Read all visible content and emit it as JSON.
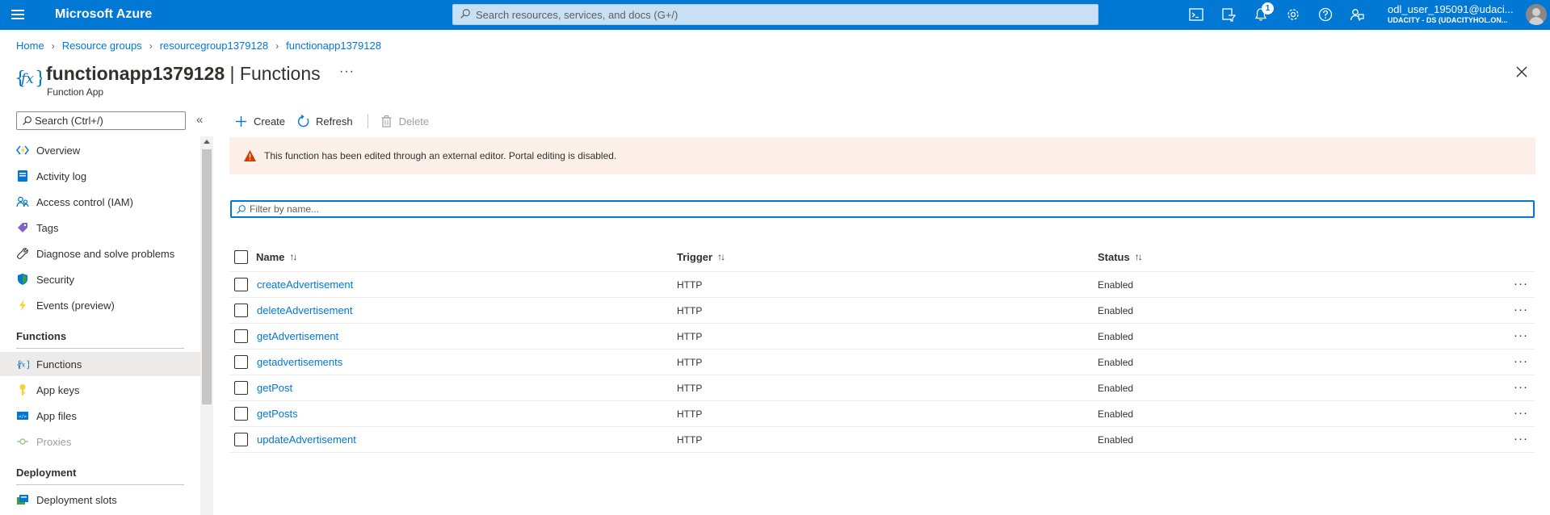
{
  "topbar": {
    "brand": "Microsoft Azure",
    "search_placeholder": "Search resources, services, and docs (G+/)",
    "notifications_count": "1",
    "user_name": "odl_user_195091@udaci...",
    "user_tenant": "UDACITY - DS (UDACITYHOL.ON...",
    "icons": [
      "cloud-shell-icon",
      "directory-filter-icon",
      "notifications-icon",
      "settings-icon",
      "help-icon",
      "feedback-icon"
    ]
  },
  "breadcrumb": {
    "items": [
      "Home",
      "Resource groups",
      "resourcegroup1379128",
      "functionapp1379128"
    ]
  },
  "header": {
    "resource_name": "functionapp1379128",
    "separator": " | ",
    "blade_name": "Functions",
    "subtitle": "Function App",
    "more": "···"
  },
  "nav": {
    "search_placeholder": "Search (Ctrl+/)",
    "collapse": "«",
    "items": [
      {
        "label": "Overview"
      },
      {
        "label": "Activity log"
      },
      {
        "label": "Access control (IAM)"
      },
      {
        "label": "Tags"
      },
      {
        "label": "Diagnose and solve problems"
      },
      {
        "label": "Security"
      },
      {
        "label": "Events (preview)"
      }
    ],
    "section_functions": "Functions",
    "functions_items": [
      {
        "label": "Functions"
      },
      {
        "label": "App keys"
      },
      {
        "label": "App files"
      },
      {
        "label": "Proxies"
      }
    ],
    "section_deployment": "Deployment",
    "deployment_items": [
      {
        "label": "Deployment slots"
      }
    ]
  },
  "toolbar": {
    "create_label": "Create",
    "refresh_label": "Refresh",
    "delete_label": "Delete"
  },
  "banner": {
    "text": "This function has been edited through an external editor. Portal editing is disabled."
  },
  "filter": {
    "placeholder": "Filter by name..."
  },
  "table": {
    "columns": [
      "Name",
      "Trigger",
      "Status"
    ],
    "sort_glyph": "↑↓",
    "rows": [
      {
        "name": "createAdvertisement",
        "trigger": "HTTP",
        "status": "Enabled"
      },
      {
        "name": "deleteAdvertisement",
        "trigger": "HTTP",
        "status": "Enabled"
      },
      {
        "name": "getAdvertisement",
        "trigger": "HTTP",
        "status": "Enabled"
      },
      {
        "name": "getadvertisements",
        "trigger": "HTTP",
        "status": "Enabled"
      },
      {
        "name": "getPost",
        "trigger": "HTTP",
        "status": "Enabled"
      },
      {
        "name": "getPosts",
        "trigger": "HTTP",
        "status": "Enabled"
      },
      {
        "name": "updateAdvertisement",
        "trigger": "HTTP",
        "status": "Enabled"
      }
    ],
    "row_more": "···"
  },
  "colors": {
    "accent": "#0078d4",
    "banner_bg": "#fdf0e9",
    "warning": "#d83b01"
  }
}
